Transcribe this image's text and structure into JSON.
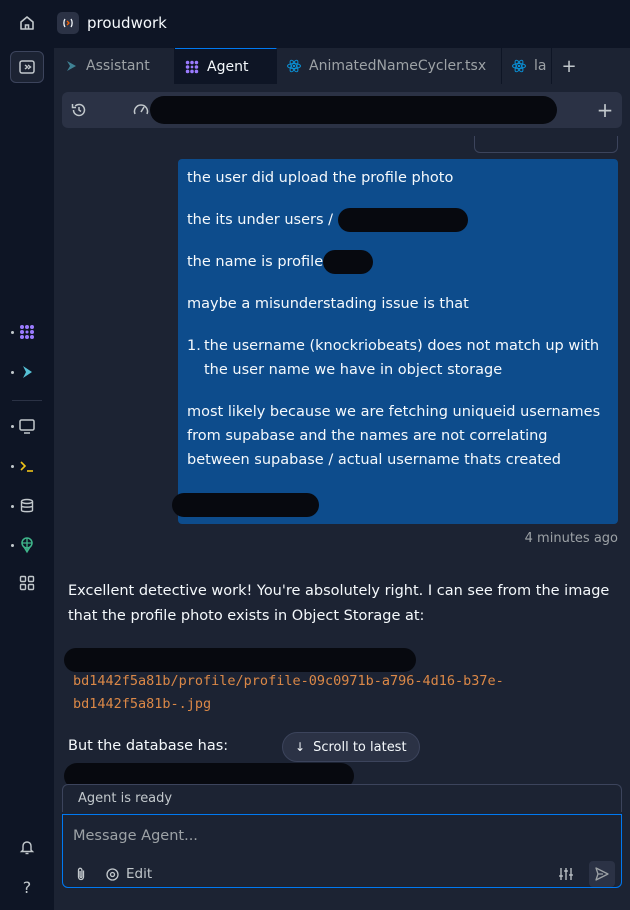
{
  "app": {
    "name": "proudwork"
  },
  "tabs": [
    {
      "label": "Assistant",
      "icon": "assistant-icon"
    },
    {
      "label": "Agent",
      "icon": "agent-icon",
      "active": true
    },
    {
      "label": "AnimatedNameCycler.tsx",
      "icon": "react-icon"
    },
    {
      "label": "la",
      "icon": "react-icon"
    }
  ],
  "toolbar": {
    "history_icon": "history-icon",
    "speed_icon": "speedometer-icon",
    "new_chat_icon": "plus-icon"
  },
  "conversation": {
    "user_message": {
      "line1": "the user did upload the profile photo",
      "line2": "the its under users /",
      "line3": "the name is profile",
      "line4": "maybe a misunderstading issue is that",
      "list_item_number": "1.",
      "list_item_text": "the username (knockriobeats) does not match up with the user name we have in object storage",
      "line5": "most likely because we are fetching uniqueid usernames from supabase and the names are not correlating between supabase / actual username thats created"
    },
    "timestamp": "4 minutes ago",
    "agent_reply": {
      "text": "Excellent detective work! You're absolutely right. I can see from the image that the profile photo exists in Object Storage at:",
      "code_line1": "bd1442f5a81b/profile/profile-09c0971b-a796-4d16-b37e-",
      "code_line2": "bd1442f5a81b-.jpg",
      "text2": "But the database has:"
    },
    "scroll_to_latest": "Scroll to latest"
  },
  "composer": {
    "status": "Agent is ready",
    "placeholder": "Message Agent...",
    "edit_label": "Edit"
  },
  "colors": {
    "background": "#0e1525",
    "panel": "#1c2333",
    "user_bubble": "#0d4c8c",
    "accent": "#0079f2",
    "code": "#db8847"
  }
}
